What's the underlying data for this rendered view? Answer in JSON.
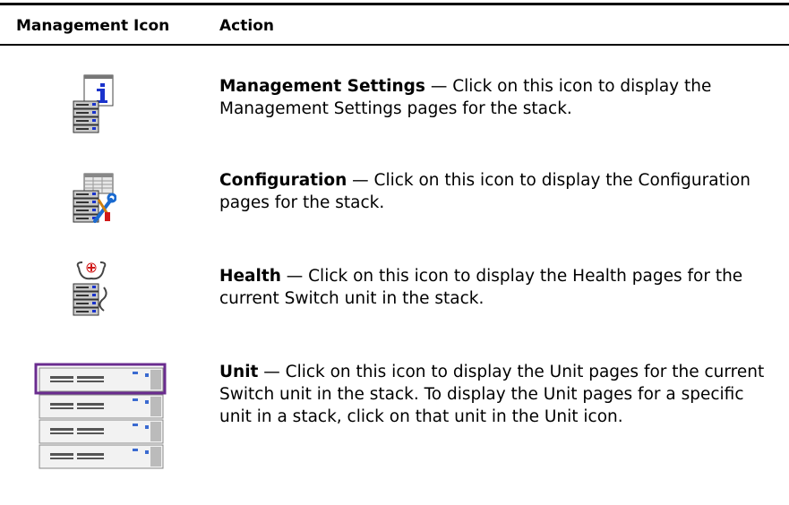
{
  "table": {
    "header_icon": "Management Icon",
    "header_action": "Action"
  },
  "rows": [
    {
      "icon": "management-settings-icon",
      "title": "Management Settings",
      "text": " — Click on this icon to display the Management Settings pages for the stack."
    },
    {
      "icon": "configuration-icon",
      "title": "Configuration",
      "text": " — Click on this icon to display the Configuration pages for the stack."
    },
    {
      "icon": "health-icon",
      "title": "Health",
      "text": " — Click on this icon to display the Health pages for the current Switch unit in the stack."
    },
    {
      "icon": "unit-icon",
      "title": "Unit",
      "text": " — Click on this icon to display the Unit pages for the current Switch unit in the stack. To display the Unit pages for a specific unit in a stack, click on that unit in the Unit icon."
    }
  ],
  "colors": {
    "rule": "#000000",
    "unit_highlight": "#6a2c8f",
    "icon_blue": "#1a33cc",
    "icon_red": "#d01818"
  }
}
